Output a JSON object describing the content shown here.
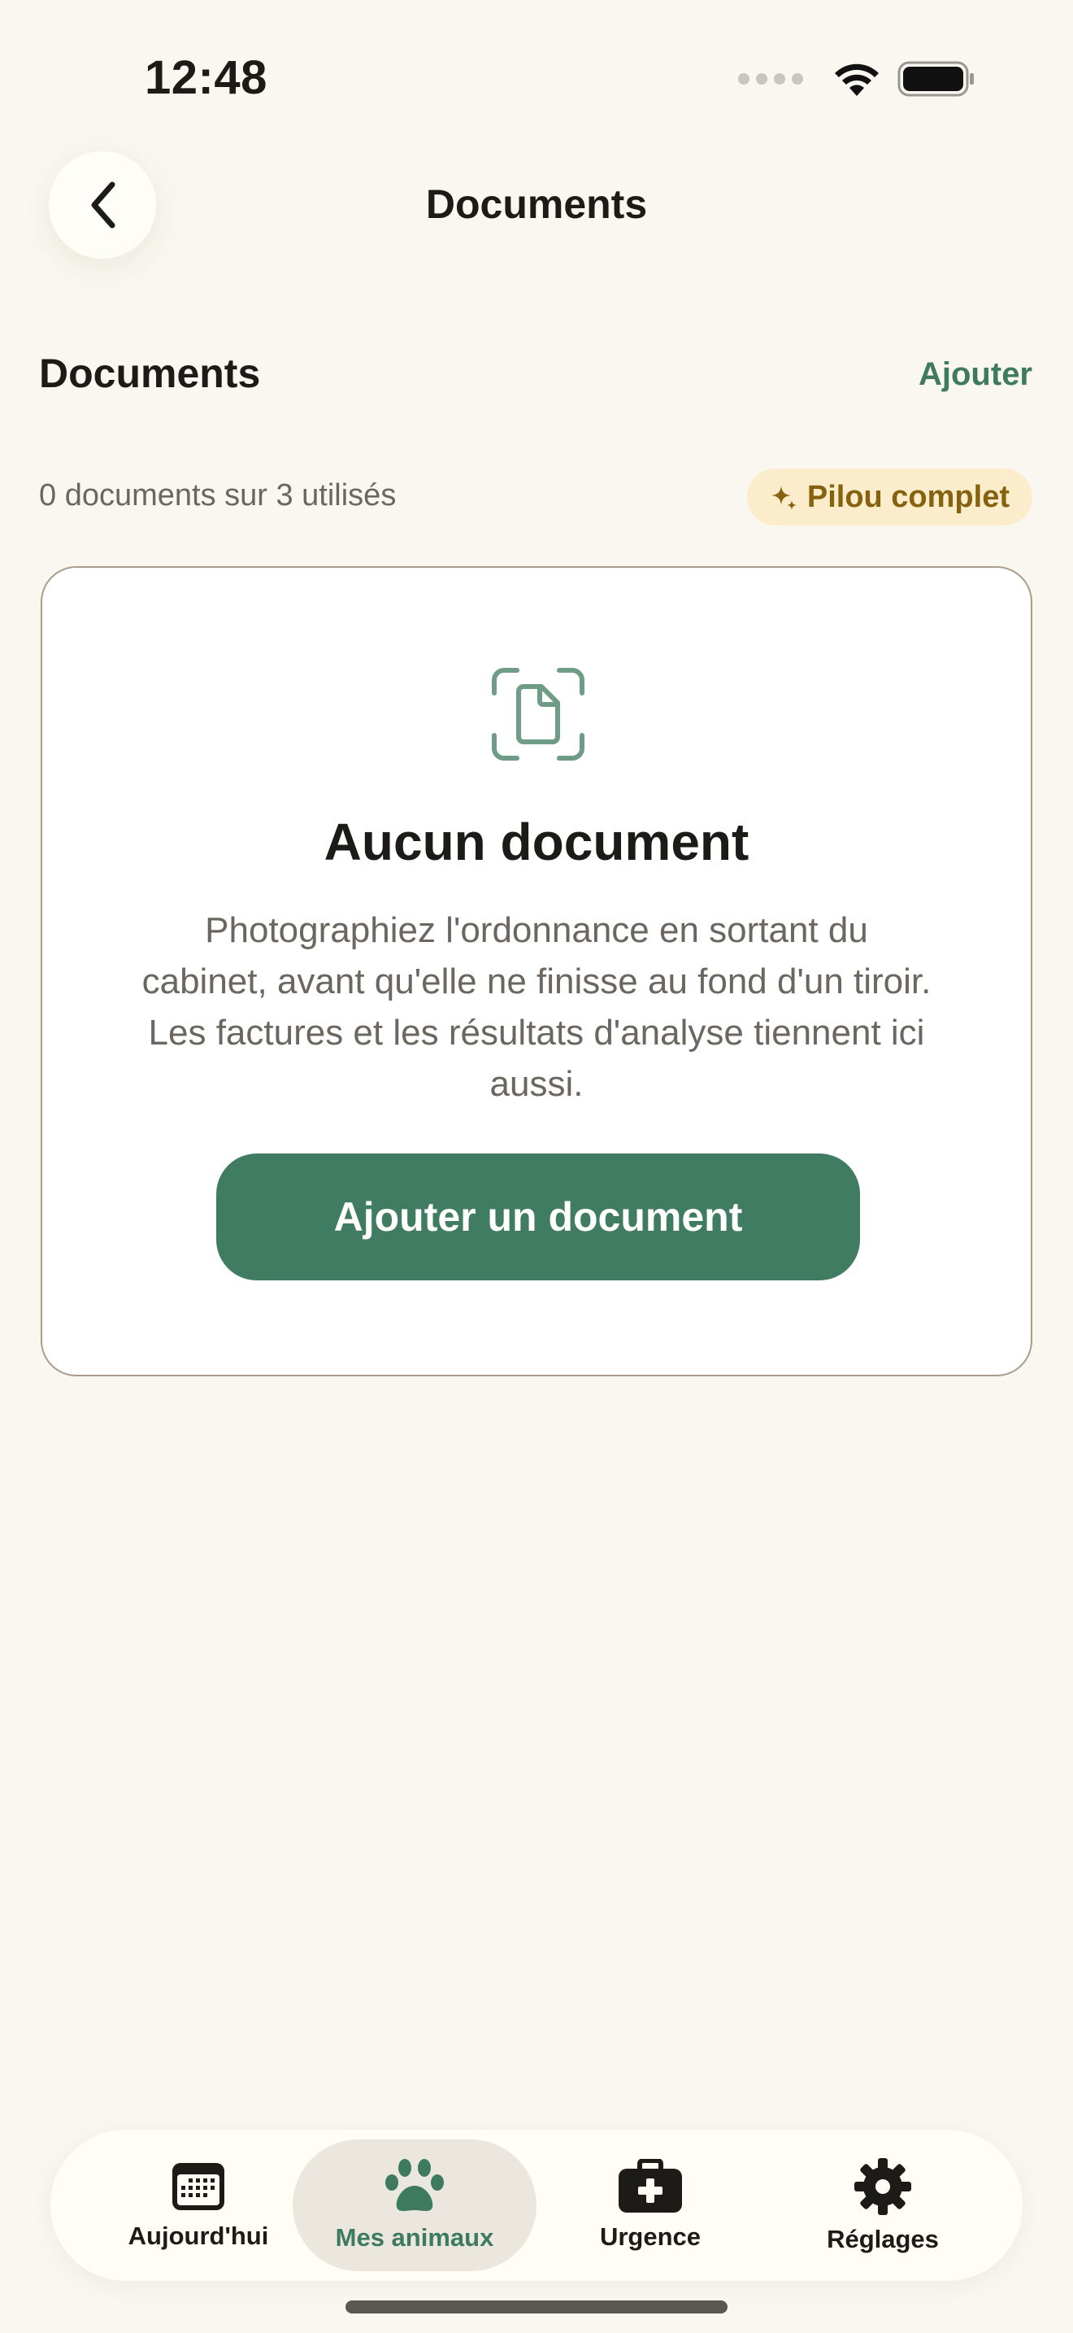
{
  "status_bar": {
    "time": "12:48"
  },
  "header": {
    "title": "Documents"
  },
  "section": {
    "title": "Documents",
    "add_label": "Ajouter"
  },
  "usage": {
    "text": "0 documents sur 3 utilisés",
    "badge": "Pilou complet"
  },
  "empty_state": {
    "title": "Aucun document",
    "description": "Photographiez l'ordonnance en sortant du cabinet, avant qu'elle ne finisse au fond d'un tiroir. Les factures et les résultats d'analyse tiennent ici aussi.",
    "button_label": "Ajouter un document"
  },
  "tab_bar": {
    "items": [
      {
        "label": "Aujourd'hui",
        "icon": "calendar-icon",
        "active": false
      },
      {
        "label": "Mes animaux",
        "icon": "paw-icon",
        "active": true
      },
      {
        "label": "Urgence",
        "icon": "first-aid-kit-icon",
        "active": false
      },
      {
        "label": "Réglages",
        "icon": "gear-icon",
        "active": false
      }
    ]
  },
  "colors": {
    "background": "#faf7f0",
    "accent_green": "#407c62",
    "badge_background": "#fbeccb",
    "badge_text": "#86620f",
    "muted_text": "#6b6660"
  }
}
